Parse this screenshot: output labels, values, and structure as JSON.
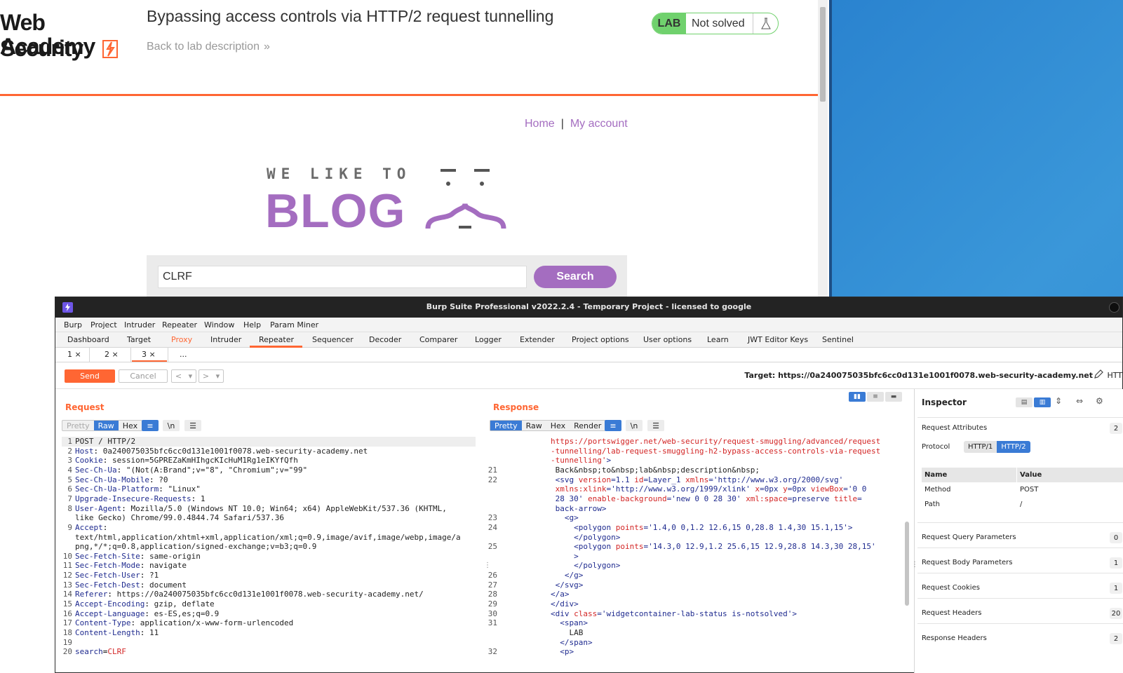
{
  "browser": {
    "logo_line1": "Web Security",
    "logo_line2": "Academy",
    "lab_title": "Bypassing access controls via HTTP/2 request tunnelling",
    "back_link": "Back to lab description",
    "lab_tag": "LAB",
    "lab_status": "Not solved",
    "nav_home": "Home",
    "nav_sep": "|",
    "nav_account": "My account",
    "blog_small": "WE LIKE TO",
    "blog_big": "BLOG",
    "search_value": "CLRF",
    "search_button": "Search"
  },
  "burp": {
    "title": "Burp Suite Professional v2022.2.4 - Temporary Project - licensed to google",
    "menu": [
      "Burp",
      "Project",
      "Intruder",
      "Repeater",
      "Window",
      "Help",
      "Param Miner"
    ],
    "tabs": [
      "Dashboard",
      "Target",
      "Proxy",
      "Intruder",
      "Repeater",
      "Sequencer",
      "Decoder",
      "Comparer",
      "Logger",
      "Extender",
      "Project options",
      "User options",
      "Learn",
      "JWT Editor Keys",
      "Sentinel"
    ],
    "subtabs": [
      "1 ×",
      "2 ×",
      "3 ×",
      "..."
    ],
    "send": "Send",
    "cancel": "Cancel",
    "prev": "<",
    "next": ">",
    "target": "Target: https://0a240075035bfc6cc0d131e1001f0078.web-security-academy.net",
    "http_trunc": "HTT",
    "request_title": "Request",
    "response_title": "Response",
    "req_views": [
      "Pretty",
      "Raw",
      "Hex"
    ],
    "resp_views": [
      "Pretty",
      "Raw",
      "Hex",
      "Render"
    ],
    "newline_label": "\\n",
    "request_lines": [
      {
        "n": "1",
        "k": "",
        "v": "POST / HTTP/2"
      },
      {
        "n": "2",
        "k": "Host",
        "v": " 0a240075035bfc6cc0d131e1001f0078.web-security-academy.net"
      },
      {
        "n": "3",
        "k": "Cookie",
        "v": " session=5GPREZaKmHIhgcKIcHuM1Rg1eIKYfQfh"
      },
      {
        "n": "4",
        "k": "Sec-Ch-Ua",
        "v": " \"(Not(A:Brand\";v=\"8\", \"Chromium\";v=\"99\""
      },
      {
        "n": "5",
        "k": "Sec-Ch-Ua-Mobile",
        "v": " ?0"
      },
      {
        "n": "6",
        "k": "Sec-Ch-Ua-Platform",
        "v": " \"Linux\""
      },
      {
        "n": "7",
        "k": "Upgrade-Insecure-Requests",
        "v": " 1"
      },
      {
        "n": "8",
        "k": "User-Agent",
        "v": " Mozilla/5.0 (Windows NT 10.0; Win64; x64) AppleWebKit/537.36 (KHTML,"
      },
      {
        "n": "",
        "k": "",
        "v": "like Gecko) Chrome/99.0.4844.74 Safari/537.36"
      },
      {
        "n": "9",
        "k": "Accept",
        "v": ""
      },
      {
        "n": "",
        "k": "",
        "v": "text/html,application/xhtml+xml,application/xml;q=0.9,image/avif,image/webp,image/a"
      },
      {
        "n": "",
        "k": "",
        "v": "png,*/*;q=0.8,application/signed-exchange;v=b3;q=0.9"
      },
      {
        "n": "10",
        "k": "Sec-Fetch-Site",
        "v": " same-origin"
      },
      {
        "n": "11",
        "k": "Sec-Fetch-Mode",
        "v": " navigate"
      },
      {
        "n": "12",
        "k": "Sec-Fetch-User",
        "v": " ?1"
      },
      {
        "n": "13",
        "k": "Sec-Fetch-Dest",
        "v": " document"
      },
      {
        "n": "14",
        "k": "Referer",
        "v": " https://0a240075035bfc6cc0d131e1001f0078.web-security-academy.net/"
      },
      {
        "n": "15",
        "k": "Accept-Encoding",
        "v": " gzip, deflate"
      },
      {
        "n": "16",
        "k": "Accept-Language",
        "v": " es-ES,es;q=0.9"
      },
      {
        "n": "17",
        "k": "Content-Type",
        "v": " application/x-www-form-urlencoded"
      },
      {
        "n": "18",
        "k": "Content-Length",
        "v": " 11"
      },
      {
        "n": "19",
        "k": "",
        "v": ""
      },
      {
        "n": "20",
        "k": "search",
        "v": "CLRF",
        "body": true
      }
    ],
    "response_lines": [
      {
        "n": "",
        "html": "<span class='attr'>https://portswigger.net/web-security/request-smuggling/advanced/request</span>"
      },
      {
        "n": "",
        "html": "<span class='attr'>-tunnelling/lab-request-smuggling-h2-bypass-access-controls-via-request</span>"
      },
      {
        "n": "",
        "html": "<span class='attr'>-tunnelling'</span><span class='tag'>&gt;</span>"
      },
      {
        "n": "21",
        "html": " <span class='txt'>Back&amp;nbsp;to&amp;nbsp;lab&amp;nbsp;description&amp;nbsp;</span>"
      },
      {
        "n": "22",
        "html": " <span class='tag'>&lt;svg</span> <span class='attr'>version</span><span class='tag'>=1.1</span> <span class='attr'>id</span><span class='tag'>=Layer_1</span> <span class='attr'>xmlns</span><span class='tag'>='http://www.w3.org/2000/svg'</span>"
      },
      {
        "n": "",
        "html": " <span class='attr'>xmlns:xlink</span><span class='tag'>='http://www.w3.org/1999/xlink'</span> <span class='attr'>x</span><span class='tag'>=0px</span> <span class='attr'>y</span><span class='tag'>=0px</span> <span class='attr'>viewBox</span><span class='tag'>='0 0</span>"
      },
      {
        "n": "",
        "html": " <span class='tag'>28 30'</span> <span class='attr'>enable-background</span><span class='tag'>='new 0 0 28 30'</span> <span class='attr'>xml:space</span><span class='tag'>=preserve</span> <span class='attr'>title</span><span class='tag'>=</span>"
      },
      {
        "n": "",
        "html": " <span class='tag'>back-arrow&gt;</span>"
      },
      {
        "n": "23",
        "html": "   <span class='tag'>&lt;g&gt;</span>"
      },
      {
        "n": "24",
        "html": "     <span class='tag'>&lt;polygon</span> <span class='attr'>points</span><span class='tag'>='1.4,0 0,1.2 12.6,15 0,28.8 1.4,30 15.1,15'&gt;</span>"
      },
      {
        "n": "",
        "html": "     <span class='tag'>&lt;/polygon&gt;</span>"
      },
      {
        "n": "25",
        "html": "     <span class='tag'>&lt;polygon</span> <span class='attr'>points</span><span class='tag'>='14.3,0 12.9,1.2 25.6,15 12.9,28.8 14.3,30 28,15'</span>"
      },
      {
        "n": "",
        "html": "     <span class='tag'>&gt;</span>"
      },
      {
        "n": "",
        "html": "     <span class='tag'>&lt;/polygon&gt;</span>"
      },
      {
        "n": "26",
        "html": "   <span class='tag'>&lt;/g&gt;</span>"
      },
      {
        "n": "27",
        "html": " <span class='tag'>&lt;/svg&gt;</span>"
      },
      {
        "n": "28",
        "html": "<span class='tag'>&lt;/a&gt;</span>"
      },
      {
        "n": "29",
        "html": "<span class='tag'>&lt;/div&gt;</span>"
      },
      {
        "n": "30",
        "html": "<span class='tag'>&lt;div</span> <span class='attr'>class</span><span class='tag'>='widgetcontainer-lab-status is-notsolved'&gt;</span>"
      },
      {
        "n": "31",
        "html": "  <span class='tag'>&lt;span&gt;</span>"
      },
      {
        "n": "",
        "html": "    <span class='txt'>LAB</span>"
      },
      {
        "n": "",
        "html": "  <span class='tag'>&lt;/span&gt;</span>"
      },
      {
        "n": "32",
        "html": "  <span class='tag'>&lt;p&gt;</span>"
      }
    ],
    "inspector": {
      "title": "Inspector",
      "request_attributes": "Request Attributes",
      "request_attributes_count": "2",
      "protocol_label": "Protocol",
      "proto_http1": "HTTP/1",
      "proto_http2": "HTTP/2",
      "col_name": "Name",
      "col_value": "Value",
      "rows": [
        {
          "name": "Method",
          "value": "POST"
        },
        {
          "name": "Path",
          "value": "/"
        }
      ],
      "sections": [
        {
          "label": "Request Query Parameters",
          "count": "0"
        },
        {
          "label": "Request Body Parameters",
          "count": "1"
        },
        {
          "label": "Request Cookies",
          "count": "1"
        },
        {
          "label": "Request Headers",
          "count": "20"
        },
        {
          "label": "Response Headers",
          "count": "2"
        }
      ]
    }
  }
}
